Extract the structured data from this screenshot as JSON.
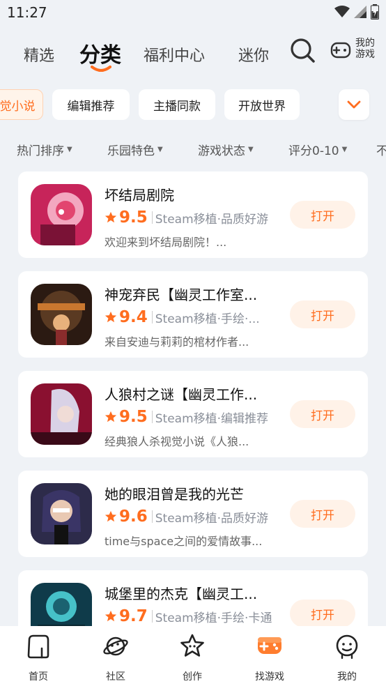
{
  "status_bar": {
    "time": "11:27",
    "icons": [
      "wifi-icon",
      "signal-icon",
      "battery-charging-icon"
    ]
  },
  "top_nav": {
    "tabs": [
      {
        "label": "精选",
        "active": false
      },
      {
        "label": "分类",
        "active": true
      },
      {
        "label": "福利中心",
        "active": false
      },
      {
        "label": "迷你",
        "active": false
      }
    ],
    "search_icon": "search-icon",
    "my_games_icon": "gamepad-icon",
    "my_games_label": "我的游戏",
    "accent_color": "#ff6d1f"
  },
  "tag_row": {
    "tags": [
      {
        "label": "觉小说",
        "active": true
      },
      {
        "label": "编辑推荐",
        "active": false
      },
      {
        "label": "主播同款",
        "active": false
      },
      {
        "label": "开放世界",
        "active": false
      }
    ],
    "expand_icon": "chevron-down-icon"
  },
  "filters": [
    {
      "label": "热门排序"
    },
    {
      "label": "乐园特色"
    },
    {
      "label": "游戏状态"
    },
    {
      "label": "评分0-10"
    },
    {
      "label": "不"
    }
  ],
  "games": [
    {
      "title": "坏结局剧院",
      "score": "9.5",
      "tags": "Steam移植·品质好游",
      "desc": "欢迎来到坏结局剧院！...",
      "button": "打开",
      "icon_colors": [
        "#c7245a",
        "#f3a7c0"
      ]
    },
    {
      "title": "神宠弃民【幽灵工作室...",
      "score": "9.4",
      "tags": "Steam移植·手绘·...",
      "desc": "来自安迪与莉莉的棺材作者...",
      "button": "打开",
      "icon_colors": [
        "#2b1a12",
        "#c9772f"
      ]
    },
    {
      "title": "人狼村之谜【幽灵工作...",
      "score": "9.5",
      "tags": "Steam移植·编辑推荐",
      "desc": "经典狼人杀视觉小说《人狼...",
      "button": "打开",
      "icon_colors": [
        "#8a1030",
        "#d9d2e6"
      ]
    },
    {
      "title": "她的眼泪曾是我的光芒",
      "score": "9.6",
      "tags": "Steam移植·品质好游",
      "desc": "time与space之间的爱情故事...",
      "button": "打开",
      "icon_colors": [
        "#2d2b4a",
        "#e9c9b3"
      ]
    },
    {
      "title": "城堡里的杰克【幽灵工...",
      "score": "9.7",
      "tags": "Steam移植·手绘·卡通",
      "desc": "",
      "button": "打开",
      "icon_colors": [
        "#0f3b4a",
        "#46c1c8"
      ]
    }
  ],
  "bottom_nav": [
    {
      "label": "首页",
      "icon": "home-icon",
      "active": false
    },
    {
      "label": "社区",
      "icon": "planet-icon",
      "active": false
    },
    {
      "label": "创作",
      "icon": "star-outline-icon",
      "active": false
    },
    {
      "label": "找游戏",
      "icon": "gamepad-icon",
      "active": true
    },
    {
      "label": "我的",
      "icon": "profile-face-icon",
      "active": false
    }
  ]
}
